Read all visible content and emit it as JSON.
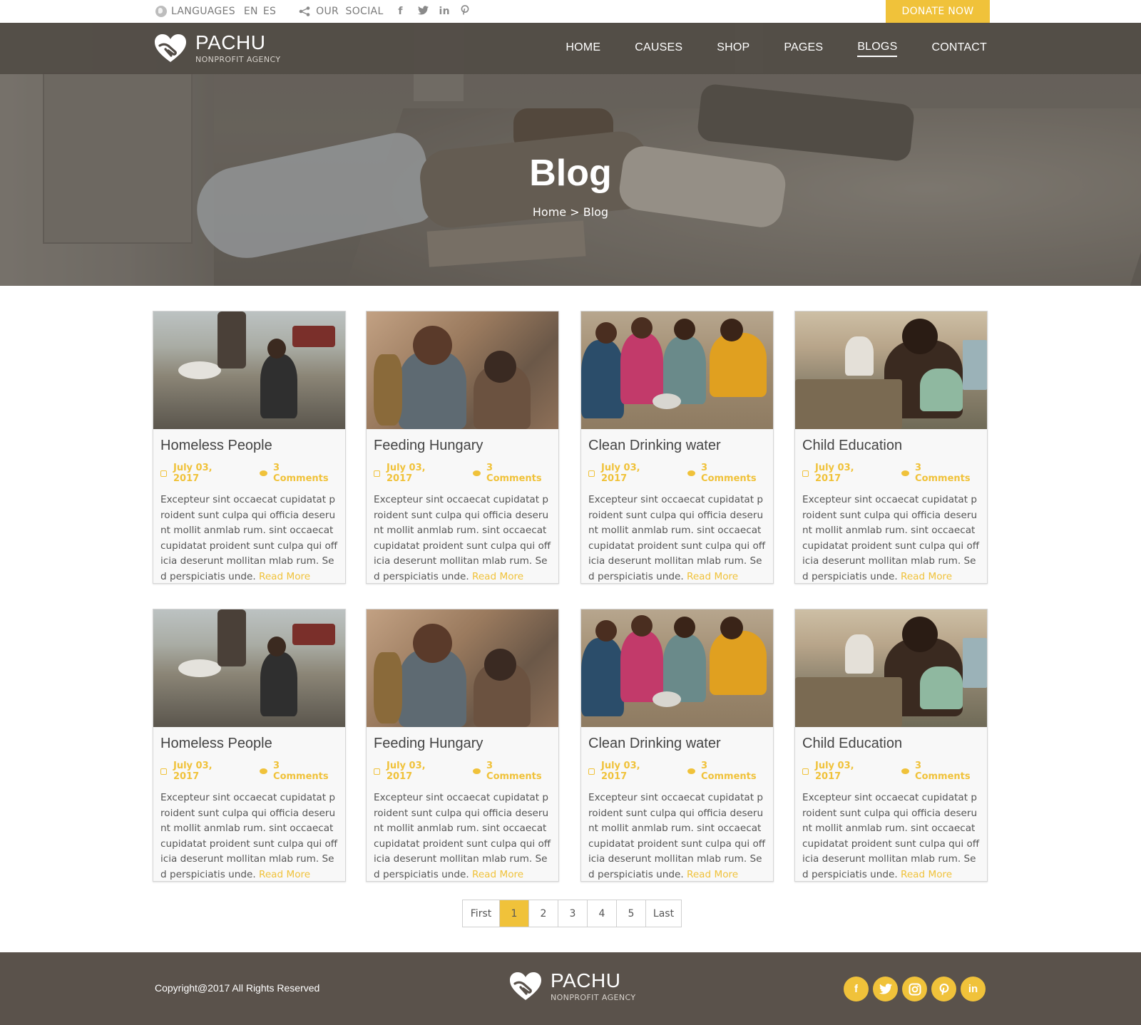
{
  "topbar": {
    "languages_label": "LANGUAGES",
    "lang_en": "EN",
    "lang_es": "ES",
    "our_social_label": "OUR  SOCIAL",
    "social_icons": [
      "facebook-icon",
      "twitter-icon",
      "linkedin-icon",
      "pinterest-icon"
    ],
    "donate_label": "DONATE NOW"
  },
  "brand": {
    "name": "PACHU",
    "tagline": "NONPROFIT AGENCY"
  },
  "nav": {
    "items": [
      {
        "label": "HOME"
      },
      {
        "label": "CAUSES"
      },
      {
        "label": "SHOP"
      },
      {
        "label": "PAGES"
      },
      {
        "label": "BLOGS",
        "active": true
      },
      {
        "label": "CONTACT"
      }
    ]
  },
  "hero": {
    "title": "Blog",
    "breadcrumb": "Home > Blog"
  },
  "cards": [
    {
      "title": "Homeless People",
      "date": "July 03, 2017",
      "comments": "3 Comments",
      "excerpt": "Excepteur sint occaecat cupidatat proident sunt culpa qui officia deserunt mollit anmlab rum. sint occaecat cupidatat proident sunt culpa qui officia deserunt mollitan mlab rum. Sed perspiciatis unde. ",
      "read_more": "Read More"
    },
    {
      "title": "Feeding Hungary",
      "date": "July 03, 2017",
      "comments": "3 Comments",
      "excerpt": "Excepteur sint occaecat cupidatat proident sunt culpa qui officia deserunt mollit anmlab rum. sint occaecat cupidatat proident sunt culpa qui officia deserunt mollitan mlab rum. Sed perspiciatis unde. ",
      "read_more": "Read More"
    },
    {
      "title": "Clean Drinking water",
      "date": "July 03, 2017",
      "comments": "3 Comments",
      "excerpt": "Excepteur sint occaecat cupidatat proident sunt culpa qui officia deserunt mollit anmlab rum. sint occaecat cupidatat proident sunt culpa qui officia deserunt mollitan mlab rum. Sed perspiciatis unde. ",
      "read_more": "Read More"
    },
    {
      "title": "Child Education",
      "date": "July 03, 2017",
      "comments": "3 Comments",
      "excerpt": "Excepteur sint occaecat cupidatat proident sunt culpa qui officia deserunt mollit anmlab rum. sint occaecat cupidatat proident sunt culpa qui officia deserunt mollitan mlab rum. Sed perspiciatis unde. ",
      "read_more": "Read More"
    },
    {
      "title": "Homeless People",
      "date": "July 03, 2017",
      "comments": "3 Comments",
      "excerpt": "Excepteur sint occaecat cupidatat proident sunt culpa qui officia deserunt mollit anmlab rum. sint occaecat cupidatat proident sunt culpa qui officia deserunt mollitan mlab rum. Sed perspiciatis unde. ",
      "read_more": "Read More"
    },
    {
      "title": "Feeding Hungary",
      "date": "July 03, 2017",
      "comments": "3 Comments",
      "excerpt": "Excepteur sint occaecat cupidatat proident sunt culpa qui officia deserunt mollit anmlab rum. sint occaecat cupidatat proident sunt culpa qui officia deserunt mollitan mlab rum. Sed perspiciatis unde. ",
      "read_more": "Read More"
    },
    {
      "title": "Clean Drinking water",
      "date": "July 03, 2017",
      "comments": "3 Comments",
      "excerpt": "Excepteur sint occaecat cupidatat proident sunt culpa qui officia deserunt mollit anmlab rum. sint occaecat cupidatat proident sunt culpa qui officia deserunt mollitan mlab rum. Sed perspiciatis unde. ",
      "read_more": "Read More"
    },
    {
      "title": "Child Education",
      "date": "July 03, 2017",
      "comments": "3 Comments",
      "excerpt": "Excepteur sint occaecat cupidatat proident sunt culpa qui officia deserunt mollit anmlab rum. sint occaecat cupidatat proident sunt culpa qui officia deserunt mollitan mlab rum. Sed perspiciatis unde. ",
      "read_more": "Read More"
    }
  ],
  "pagination": {
    "first": "First",
    "pages": [
      "1",
      "2",
      "3",
      "4",
      "5"
    ],
    "current": "1",
    "last": "Last"
  },
  "footer": {
    "copyright": "Copyright@2017 All Rights Reserved",
    "social_icons": [
      "facebook-icon",
      "twitter-icon",
      "instagram-icon",
      "pinterest-icon",
      "linkedin-icon"
    ]
  },
  "colors": {
    "accent": "#f0c23a",
    "nav_bg": "#524c46",
    "footer_bg": "#5a524b"
  }
}
